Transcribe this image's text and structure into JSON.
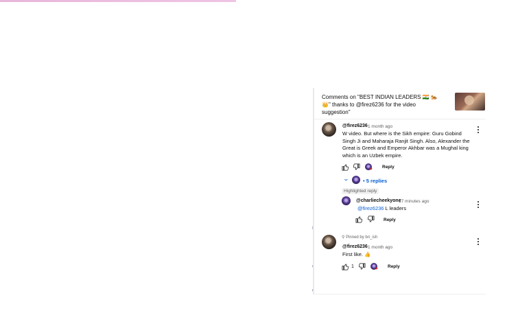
{
  "header": {
    "text": "Comments on \"BEST INDIAN LEADERS 🇮🇳 🐅 👑\" thanks to @firez6236 for the video suggestion\""
  },
  "comment1": {
    "author": "@firez6236",
    "time": "1 month ago",
    "text": "W video. But where is the Sikh empire: Guru Gobind Singh Ji and Maharaja Ranjit Singh. Also, Alexander the Great is Greek and Emperor Akhbar was a Mughal king which is an Uzbek empire.",
    "reply_label": "Reply",
    "replies_label": "5 replies"
  },
  "highlighted": {
    "label": "Highlighted reply",
    "author": "@charliecheekyone",
    "time": "17 minutes ago",
    "mention": "@firez6236",
    "text": " L leaders",
    "reply_label": "Reply"
  },
  "comment2": {
    "pinned_label": "Pinned by bri_ish",
    "author": "@firez6236",
    "time": "1 month ago",
    "text": "First like. 👍",
    "like_count": "1",
    "reply_label": "Reply"
  },
  "left_glyphs": [
    "r,",
    "e",
    "o"
  ],
  "colors": {
    "link": "#065fd4",
    "text": "#0f0f0f",
    "muted": "#606060"
  }
}
